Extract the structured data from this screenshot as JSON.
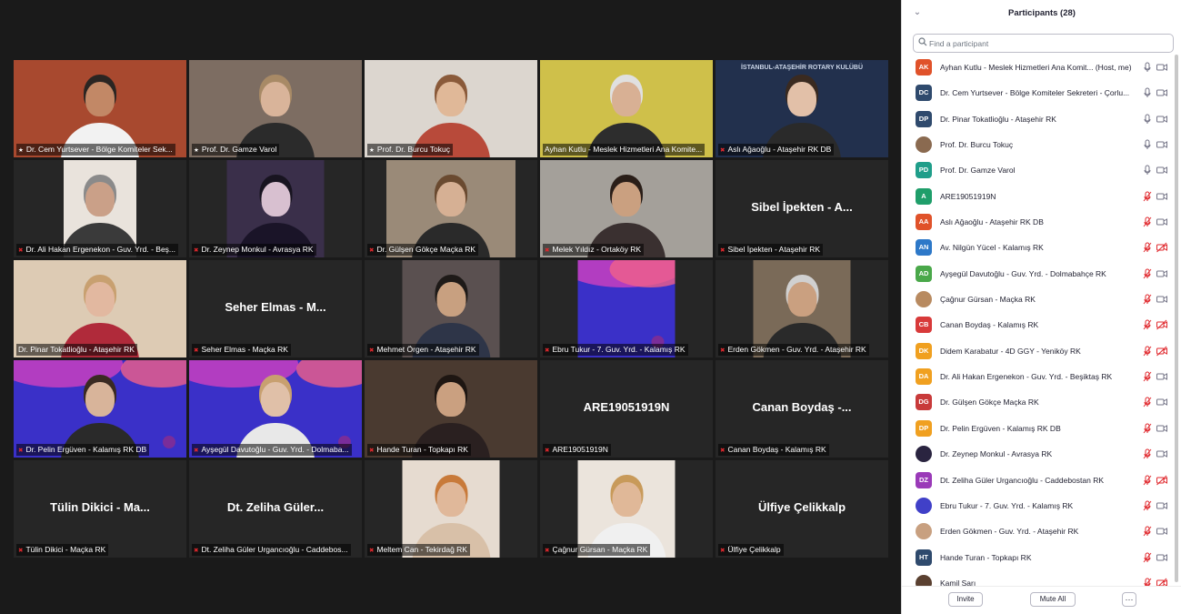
{
  "panel": {
    "title": "Participants (28)",
    "search_placeholder": "Find a participant",
    "invite_label": "Invite",
    "mute_all_label": "Mute All",
    "more_label": "···",
    "participants": [
      {
        "initials": "AK",
        "color": "#e0522a",
        "name": "Ayhan Kutlu - Meslek Hizmetleri Ana Komit... (Host, me)",
        "mic": "on",
        "cam": "on"
      },
      {
        "initials": "DC",
        "color": "#2f4a6d",
        "name": "Dr. Cem Yurtsever - Bölge Komiteler Sekreteri - Çorlu...",
        "mic": "on",
        "cam": "on"
      },
      {
        "initials": "DP",
        "color": "#2f4a6d",
        "name": "Dr. Pinar Tokatlioğlu - Ataşehir RK",
        "mic": "on",
        "cam": "on"
      },
      {
        "initials": "",
        "color": "#8a6a50",
        "name": "Prof. Dr. Burcu Tokuç",
        "mic": "on",
        "cam": "on",
        "photo": true
      },
      {
        "initials": "PD",
        "color": "#1f9e8a",
        "name": "Prof. Dr. Gamze Varol",
        "mic": "on",
        "cam": "on"
      },
      {
        "initials": "A",
        "color": "#1f9e6a",
        "name": "ARE19051919N",
        "mic": "muted",
        "cam": "on"
      },
      {
        "initials": "AA",
        "color": "#e0522a",
        "name": "Aslı Ağaoğlu - Ataşehir RK DB",
        "mic": "muted",
        "cam": "on"
      },
      {
        "initials": "AN",
        "color": "#2d78c8",
        "name": "Av. Nilgün Yücel - Kalamış RK",
        "mic": "muted",
        "cam": "off"
      },
      {
        "initials": "AD",
        "color": "#4aa84a",
        "name": "Ayşegül Davutoğlu - Guv. Yrd. - Dolmabahçe RK",
        "mic": "muted",
        "cam": "on"
      },
      {
        "initials": "",
        "color": "#b88a60",
        "name": "Çağnur Gürsan - Maçka RK",
        "mic": "muted",
        "cam": "on",
        "photo": true
      },
      {
        "initials": "CB",
        "color": "#d83a3a",
        "name": "Canan Boydaş - Kalamış RK",
        "mic": "muted",
        "cam": "off"
      },
      {
        "initials": "DK",
        "color": "#f0a020",
        "name": "Didem Karabatur - 4D GGY - Yeniköy RK",
        "mic": "muted",
        "cam": "off"
      },
      {
        "initials": "DA",
        "color": "#f0a020",
        "name": "Dr. Ali Hakan Ergenekon - Guv. Yrd. - Beşiktaş RK",
        "mic": "muted",
        "cam": "on"
      },
      {
        "initials": "DG",
        "color": "#c83a3a",
        "name": "Dr. Gülşen Gökçe Maçka RK",
        "mic": "muted",
        "cam": "on"
      },
      {
        "initials": "DP",
        "color": "#f0a020",
        "name": "Dr. Pelin Ergüven - Kalamış RK DB",
        "mic": "muted",
        "cam": "on"
      },
      {
        "initials": "",
        "color": "#2a2440",
        "name": "Dr. Zeynep Monkul - Avrasya RK",
        "mic": "muted",
        "cam": "on",
        "photo": true
      },
      {
        "initials": "DZ",
        "color": "#9a3ab8",
        "name": "Dt. Zeliha Güler Urgancıoğlu - Caddebostan RK",
        "mic": "muted",
        "cam": "off"
      },
      {
        "initials": "",
        "color": "#4040c8",
        "name": "Ebru Tukur - 7. Guv. Yrd. - Kalamış RK",
        "mic": "muted",
        "cam": "on",
        "photo": true
      },
      {
        "initials": "",
        "color": "#c8a080",
        "name": "Erden Gökmen - Guv. Yrd. - Ataşehir RK",
        "mic": "muted",
        "cam": "on",
        "photo": true
      },
      {
        "initials": "HT",
        "color": "#2f4a6d",
        "name": "Hande Turan - Topkapı RK",
        "mic": "muted",
        "cam": "on"
      },
      {
        "initials": "",
        "color": "#5a4030",
        "name": "Kamil Sarı",
        "mic": "muted",
        "cam": "off",
        "photo": true
      }
    ]
  },
  "gallery": {
    "tiles": [
      {
        "label": "Dr. Cem Yurtsever - Bölge Komiteler Sek...",
        "icon": "pin",
        "active": true,
        "bg": "#b96a3e",
        "vw": 190,
        "skin": "#c28866",
        "hair": "#2a2522",
        "shirt": "#f2f2f2",
        "backdrop": "#a8492f"
      },
      {
        "label": "Prof. Dr. Gamze Varol",
        "icon": "pin",
        "bg": "#6a5a50",
        "vw": 190,
        "skin": "#d9b49a",
        "hair": "#a88a66",
        "shirt": "#2b2b2b",
        "backdrop": "#7d6d62"
      },
      {
        "label": "Prof. Dr. Burcu Tokuç",
        "icon": "pin",
        "bg": "#d8d2cb",
        "vw": 190,
        "skin": "#e0b898",
        "hair": "#8a5a3a",
        "shirt": "#b84a3a",
        "backdrop": "#dcd6cf"
      },
      {
        "label": "Ayhan Kutlu - Meslek Hizmetleri Ana Komite...",
        "icon": "none",
        "bg": "#d4c020",
        "vw": 190,
        "skin": "#d8b094",
        "hair": "#e0e0e0",
        "shirt": "#2d2d2d",
        "backdrop": "#cfc04a"
      },
      {
        "label": "Aslı Ağaoğlu - Ataşehir RK DB",
        "icon": "mic",
        "bg": "#1e2a44",
        "vw": 190,
        "skin": "#e2c0a8",
        "hair": "#3a2a20",
        "shirt": "#2a2a2a",
        "backdrop": "#22304d",
        "banner": "İSTANBUL-ATAŞEHİR ROTARY KULÜBÜ"
      },
      {
        "label": "Dr. Ali Hakan Ergenekon - Guv. Yrd. - Beş...",
        "icon": "mic",
        "bg": "#e8e4de",
        "vw": 80,
        "skin": "#caa088",
        "hair": "#8a8a8a",
        "shirt": "#3a3a3a",
        "backdrop": "#e9e3dc"
      },
      {
        "label": "Dr. Zeynep Monkul - Avrasya RK",
        "icon": "mic",
        "bg": "#2a2238",
        "vw": 107,
        "skin": "#d8c0d0",
        "hair": "#181420",
        "shirt": "#1a1428",
        "backdrop": "#3a2f4a"
      },
      {
        "label": "Dr. Gülşen Gökçe Maçka RK",
        "icon": "mic",
        "bg": "#4a3e36",
        "vw": 142,
        "skin": "#d6b094",
        "hair": "#6a4a30",
        "shirt": "#2a2a2a",
        "backdrop": "#9a8a78"
      },
      {
        "label": "Melek Yıldız - Ortaköy RK",
        "icon": "mic",
        "bg": "#8a8a8a",
        "vw": 190,
        "skin": "#caa080",
        "hair": "#2a1e18",
        "shirt": "#3a3030",
        "backdrop": "#a4a09a"
      },
      {
        "label": "Sibel İpekten - Ataşehir RK",
        "icon": "mic",
        "bg": "",
        "vw": 0,
        "big": "Sibel İpekten - A..."
      },
      {
        "label": "Dr. Pinar Tokatlioğlu - Ataşehir RK",
        "icon": "none",
        "bg": "#d8c8b0",
        "vw": 190,
        "skin": "#e2b8a0",
        "hair": "#c8a070",
        "shirt": "#b02a3a",
        "backdrop": "#ddcbb4"
      },
      {
        "label": "Seher Elmas - Maçka RK",
        "icon": "mic",
        "bg": "",
        "vw": 0,
        "big": "Seher Elmas - M..."
      },
      {
        "label": "Mehmet Örgen - Ataşehir RK",
        "icon": "mic",
        "bg": "#3a3838",
        "vw": 107,
        "skin": "#c8a080",
        "hair": "#1e1a18",
        "shirt": "#2e3548",
        "backdrop": "#5a5050"
      },
      {
        "label": "Ebru Tukur - 7. Guv. Yrd. - Kalamış RK",
        "icon": "mic",
        "bg": "#3a30c8",
        "vw": 107,
        "video": "rotary"
      },
      {
        "label": "Erden Gökmen - Guv. Yrd. - Ataşehir RK",
        "icon": "mic",
        "bg": "#5a4a3a",
        "vw": 107,
        "skin": "#caa080",
        "hair": "#d0d0d0",
        "shirt": "#2a2a2a",
        "backdrop": "#7a6a58"
      },
      {
        "label": "Dr. Pelin Ergüven - Kalamış RK DB",
        "icon": "mic",
        "bg": "#3a30c8",
        "vw": 190,
        "video": "rotary-person",
        "skin": "#d8b49a",
        "hair": "#3a2a22",
        "shirt": "#2a2a2a"
      },
      {
        "label": "Ayşegül Davutoğlu - Guv. Yrd. - Dolmaba...",
        "icon": "mic",
        "bg": "#3a30c8",
        "vw": 190,
        "video": "rotary-person",
        "skin": "#e0c0a8",
        "hair": "#c8a070",
        "shirt": "#e8e8e8"
      },
      {
        "label": "Hande Turan - Topkapı RK",
        "icon": "mic",
        "bg": "#3a2e26",
        "vw": 190,
        "skin": "#caa080",
        "hair": "#1e1612",
        "shirt": "#2a2020",
        "backdrop": "#4a3a30"
      },
      {
        "label": "ARE19051919N",
        "icon": "mic",
        "bg": "",
        "vw": 0,
        "big": "ARE19051919N"
      },
      {
        "label": "Canan Boydaş - Kalamış RK",
        "icon": "mic",
        "bg": "",
        "vw": 0,
        "big": "Canan Boydaş -..."
      },
      {
        "label": "Tülin Dikici - Maçka RK",
        "icon": "mic",
        "bg": "",
        "vw": 0,
        "big": "Tülin Dikici - Ma..."
      },
      {
        "label": "Dt. Zeliha Güler Urgancıoğlu - Caddebos...",
        "icon": "mic",
        "bg": "",
        "vw": 0,
        "big": "Dt. Zeliha Güler..."
      },
      {
        "label": "Meltem Can - Tekirdağ RK",
        "icon": "mic",
        "bg": "#e0d4c8",
        "vw": 107,
        "skin": "#e0b89a",
        "hair": "#c87a3a",
        "shirt": "#d8c0a8",
        "backdrop": "#e6dbd0"
      },
      {
        "label": "Çağnur Gürsan - Maçka RK",
        "icon": "mic",
        "bg": "#e8e0d8",
        "vw": 107,
        "skin": "#e0b898",
        "hair": "#c89a5a",
        "shirt": "#f0f0f0",
        "backdrop": "#ebe4dc"
      },
      {
        "label": "Ülfiye Çelikkalp",
        "icon": "mic",
        "bg": "",
        "vw": 0,
        "big": "Ülfiye Çelikkalp"
      }
    ]
  }
}
